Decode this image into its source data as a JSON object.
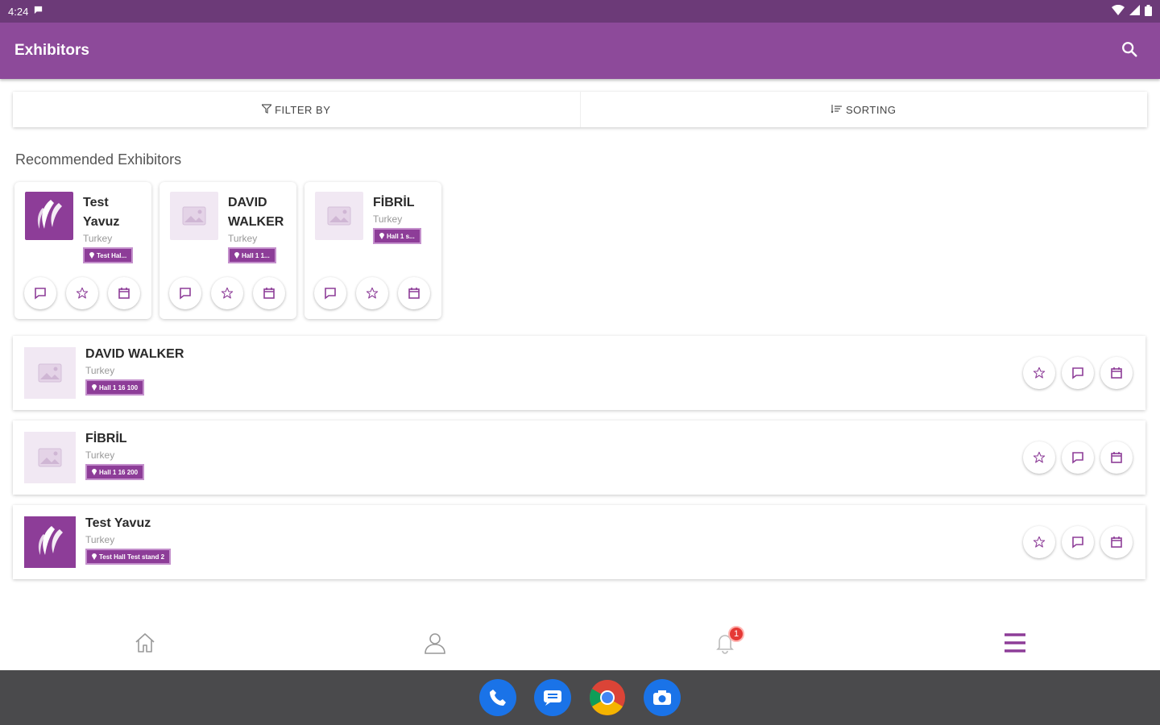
{
  "status_bar": {
    "time": "4:24"
  },
  "app_bar": {
    "title": "Exhibitors"
  },
  "filters": {
    "filter_label": "FILTER BY",
    "sort_label": "SORTING"
  },
  "section": {
    "title": "Recommended Exhibitors"
  },
  "recommended": [
    {
      "name": "Test Yavuz",
      "country": "Turkey",
      "location": "Test Hal...",
      "logo": "brand"
    },
    {
      "name": "DAVID WALKER",
      "country": "Turkey",
      "location": "Hall 1 1...",
      "logo": "placeholder"
    },
    {
      "name": "FİBRİL",
      "country": "Turkey",
      "location": "Hall 1 s...",
      "logo": "placeholder"
    }
  ],
  "exhibitors": [
    {
      "name": "DAVID WALKER",
      "country": "Turkey",
      "location": "Hall 1 16 100",
      "logo": "placeholder"
    },
    {
      "name": "FİBRİL",
      "country": "Turkey",
      "location": "Hall 1 16 200",
      "logo": "placeholder"
    },
    {
      "name": "Test Yavuz",
      "country": "Turkey",
      "location": "Test Hall Test stand 2",
      "logo": "brand"
    }
  ],
  "bottom_nav": {
    "notification_count": "1"
  },
  "colors": {
    "primary": "#8d4a9a",
    "status": "#6c3a78",
    "accent": "#8d3d98",
    "badge_red": "#e53935"
  },
  "icons": [
    "search-icon",
    "filter-icon",
    "sort-icon",
    "chat-icon",
    "star-icon",
    "calendar-icon",
    "home-icon",
    "person-icon",
    "bell-icon",
    "menu-icon",
    "image-placeholder-icon"
  ]
}
